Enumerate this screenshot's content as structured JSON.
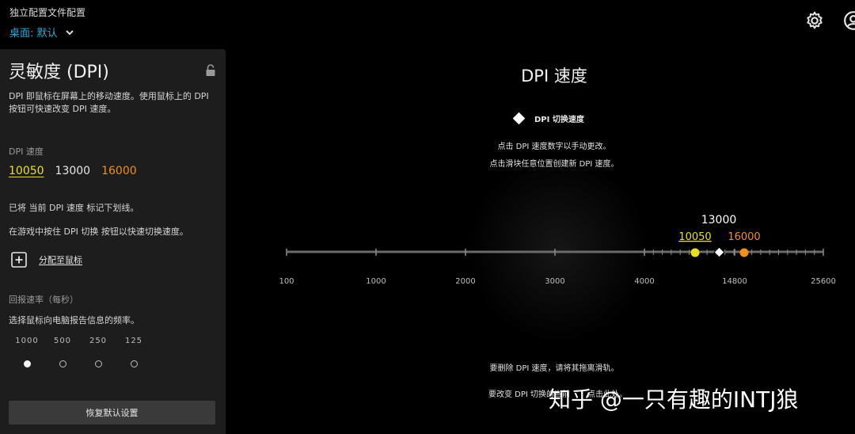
{
  "header": {
    "profile_title": "独立配置文件配置",
    "profile_select": "桌面: 默认"
  },
  "panel": {
    "title": "灵敏度 (DPI)",
    "description": "DPI 即鼠标在屏幕上的移动速度。使用鼠标上的 DPI 按钮可快速改变 DPI 速度。",
    "dpi_section_label": "DPI 速度",
    "dpi_values": [
      {
        "label": "10050",
        "state": "current"
      },
      {
        "label": "13000",
        "state": "normal"
      },
      {
        "label": "16000",
        "state": "orange"
      }
    ],
    "underline_note": "已将 当前 DPI 速度 标记下划线。",
    "shift_note": "在游戏中按住 DPI 切换 按钮以快速切换速度。",
    "assign_label": "分配至鼠标",
    "report_rate_label": "回报速率（每秒）",
    "report_rate_desc": "选择鼠标向电脑报告信息的频率。",
    "report_rates": [
      {
        "label": "1000",
        "selected": true
      },
      {
        "label": "500",
        "selected": false
      },
      {
        "label": "250",
        "selected": false
      },
      {
        "label": "125",
        "selected": false
      }
    ],
    "reset_button": "恢复默认设置"
  },
  "main": {
    "title": "DPI 速度",
    "legend_label": "DPI 切换速度",
    "hint_1": "点击 DPI 速度数字以手动更改。",
    "hint_2": "点击滑块任意位置创建新 DPI 速度。",
    "hint_3": "要删除 DPI 速度，请将其拖离滑轨。",
    "hint_4": "要改变 DPI 切换的当前",
    "hint_4_tail": "点击此处。"
  },
  "slider": {
    "axis_labels": [
      "100",
      "1000",
      "2000",
      "3000",
      "4000",
      "14800",
      "25600"
    ],
    "markers": [
      {
        "label": "10050",
        "color": "#e8e020",
        "kind": "current"
      },
      {
        "label": "13000",
        "color": "#ffffff",
        "kind": "shift"
      },
      {
        "label": "16000",
        "color": "#f0901a",
        "kind": "normal"
      }
    ]
  },
  "watermark": "知乎 @一只有趣的INTJ狼",
  "colors": {
    "accent": "#2fa8d8",
    "current": "#e8e020",
    "orange": "#f0901a"
  }
}
